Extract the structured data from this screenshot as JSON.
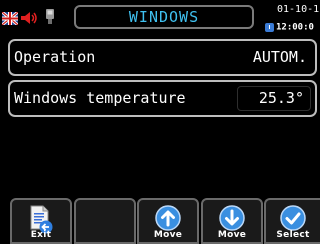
{
  "header": {
    "title": "WINDOWS",
    "date": "01-10-1",
    "time": "12:00:0",
    "icons": [
      "uk-flag-icon",
      "speaker-mute-icon",
      "lamp-icon",
      "clock-icon"
    ]
  },
  "rows": [
    {
      "label": "Operation",
      "value": "AUTOM."
    },
    {
      "label": "Windows temperature",
      "value": "25.3°"
    }
  ],
  "softkeys": {
    "exit": {
      "label": "Exit",
      "icon": "document-arrow-icon"
    },
    "empty": {
      "label": ""
    },
    "move_up": {
      "label": "Move",
      "icon": "arrow-up-circle-icon"
    },
    "move_down": {
      "label": "Move",
      "icon": "arrow-down-circle-icon"
    },
    "select": {
      "label": "Select",
      "icon": "checkmark-circle-icon"
    }
  },
  "colors": {
    "title": "#3fc0ef",
    "softkey_bg": "#1a1a1a",
    "icon_blue": "#3a8fe0"
  }
}
